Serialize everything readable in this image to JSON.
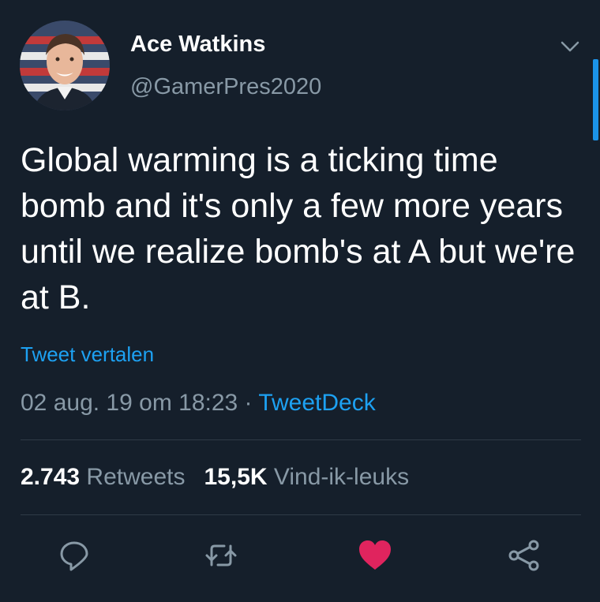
{
  "user": {
    "display_name": "Ace Watkins",
    "handle": "@GamerPres2020"
  },
  "tweet": {
    "text": "Global warming is a ticking time bomb and it's only a few more years until we realize bomb's at A but we're at B.",
    "translate_link": "Tweet vertalen",
    "timestamp": "02 aug. 19 om 18:23",
    "separator": " · ",
    "source": "TweetDeck"
  },
  "stats": {
    "retweets_count": "2.743",
    "retweets_label": "Retweets",
    "likes_count": "15,5K",
    "likes_label": "Vind-ik-leuks"
  },
  "actions": {
    "reply_icon": "reply-icon",
    "retweet_icon": "retweet-icon",
    "like_icon": "heart-icon",
    "share_icon": "share-icon"
  },
  "colors": {
    "background": "#151f2b",
    "accent": "#1da1f2",
    "like": "#e0245e",
    "muted": "#8899a6"
  }
}
